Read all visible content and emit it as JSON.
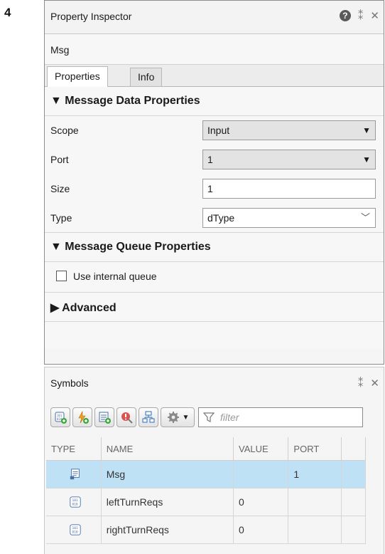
{
  "step_number": "4",
  "property_inspector": {
    "title": "Property Inspector",
    "object_name": "Msg",
    "tabs": [
      "Properties",
      "Info"
    ],
    "section_message_data": "▼ Message Data Properties",
    "fields": {
      "scope": {
        "label": "Scope",
        "value": "Input"
      },
      "port": {
        "label": "Port",
        "value": "1"
      },
      "size": {
        "label": "Size",
        "value": "1"
      },
      "type": {
        "label": "Type",
        "value": "dType"
      }
    },
    "section_message_queue": "▼ Message Queue Properties",
    "use_internal_queue": {
      "label": "Use internal queue",
      "checked": false
    },
    "section_advanced": "▶ Advanced"
  },
  "symbols": {
    "title": "Symbols",
    "filter_placeholder": "filter",
    "columns": [
      "TYPE",
      "NAME",
      "VALUE",
      "PORT"
    ],
    "rows": [
      {
        "type_icon": "message-icon",
        "name": "Msg",
        "value": "",
        "port": "1",
        "selected": true
      },
      {
        "type_icon": "local-data-icon",
        "name": "leftTurnReqs",
        "value": "0",
        "port": "",
        "selected": false
      },
      {
        "type_icon": "local-data-icon",
        "name": "rightTurnReqs",
        "value": "0",
        "port": "",
        "selected": false
      }
    ]
  },
  "colors": {
    "selected_row": "#bfe1f5",
    "accent_green": "#3aa63a"
  }
}
